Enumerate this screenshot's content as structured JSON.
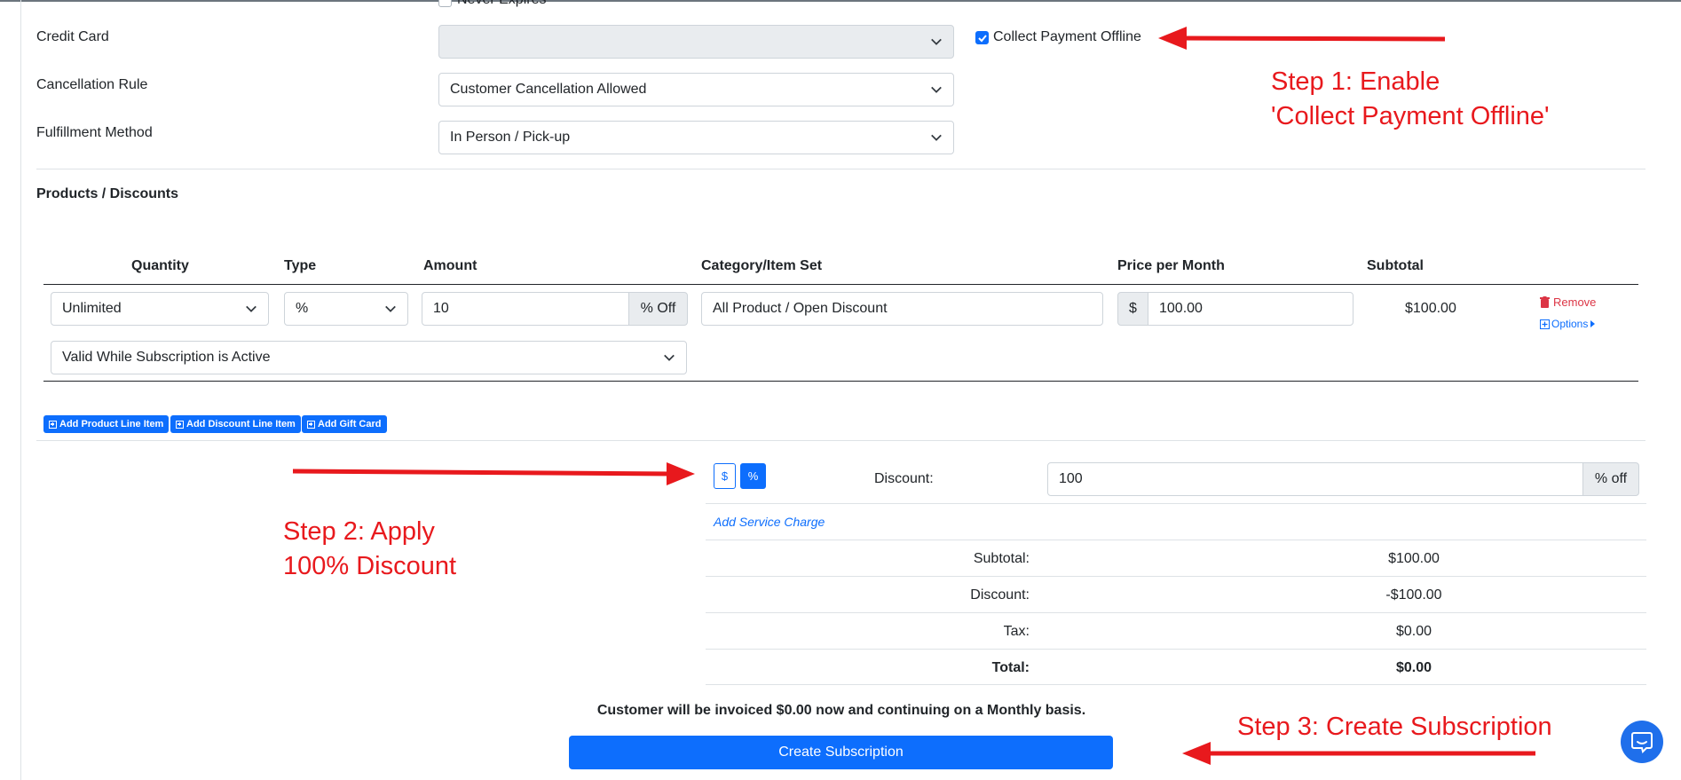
{
  "form": {
    "never_expires_label": "Never Expires",
    "credit_card_label": "Credit Card",
    "credit_card_value": "",
    "collect_payment_offline_label": "Collect Payment Offline",
    "collect_payment_offline_checked": true,
    "cancellation_rule_label": "Cancellation Rule",
    "cancellation_rule_value": "Customer Cancellation Allowed",
    "fulfillment_method_label": "Fulfillment Method",
    "fulfillment_method_value": "In Person / Pick-up"
  },
  "products": {
    "section_title": "Products / Discounts",
    "columns": [
      "Quantity",
      "Type",
      "Amount",
      "Category/Item Set",
      "Price per Month",
      "Subtotal"
    ],
    "row": {
      "quantity": "Unlimited",
      "type": "%",
      "amount": "10",
      "amount_suffix": "% Off",
      "category": "All Product / Open Discount",
      "price_prefix": "$",
      "price": "100.00",
      "subtotal": "$100.00",
      "remove_label": "Remove",
      "options_label": "Options",
      "validity": "Valid While Subscription is Active"
    },
    "buttons": {
      "add_product": "Add Product Line Item",
      "add_discount": "Add Discount Line Item",
      "add_gift_card": "Add Gift Card"
    }
  },
  "summary": {
    "toggle_dollar": "$",
    "toggle_percent": "%",
    "discount_label": "Discount:",
    "discount_value": "100",
    "discount_suffix": "% off",
    "add_service_charge": "Add Service Charge",
    "rows": [
      {
        "label": "Subtotal:",
        "value": "$100.00"
      },
      {
        "label": "Discount:",
        "value": "-$100.00"
      },
      {
        "label": "Tax:",
        "value": "$0.00"
      },
      {
        "label": "Total:",
        "value": "$0.00"
      }
    ],
    "invoice_note": "Customer will be invoiced $0.00 now and continuing on a Monthly basis.",
    "create_button": "Create Subscription"
  },
  "annotations": {
    "step1_line1": "Step 1: Enable",
    "step1_line2": "'Collect Payment Offline'",
    "step2_line1": "Step 2: Apply",
    "step2_line2": "100% Discount",
    "step3": "Step 3: Create Subscription"
  },
  "colors": {
    "primary": "#0d6efd",
    "annotation_red": "#e8191d",
    "danger": "#dc3545"
  },
  "icons": [
    "chevron-down-icon",
    "check-icon",
    "trash-icon",
    "plus-square-icon",
    "caret-right-icon",
    "chat-bubble-icon",
    "arrow-left-icon",
    "arrow-right-icon"
  ]
}
